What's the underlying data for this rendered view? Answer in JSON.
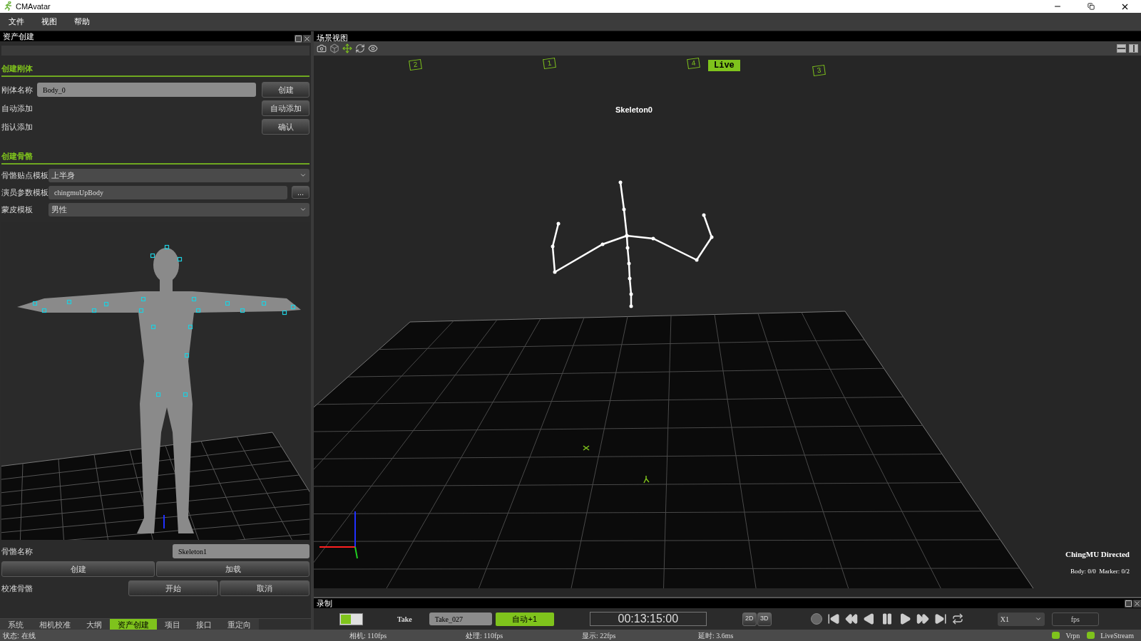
{
  "window": {
    "title": "CMAvatar"
  },
  "menu": [
    "文件",
    "视图",
    "帮助"
  ],
  "left_panel": {
    "title": "资产创建",
    "rigid_section": {
      "heading": "创建刚体",
      "rows": [
        {
          "label": "刚体名称",
          "kind": "field",
          "value": "Body_0",
          "button": "创建"
        },
        {
          "label": "自动添加",
          "kind": "button",
          "button": "自动添加"
        },
        {
          "label": "指认添加",
          "kind": "button",
          "button": "确认"
        }
      ]
    },
    "skeleton_section": {
      "heading": "创建骨骼",
      "rows": [
        {
          "label": "骨骼贴点模板",
          "kind": "dropdown",
          "value": "上半身"
        },
        {
          "label": "演员参数模板",
          "kind": "browse",
          "value": "chingmuUpBody",
          "button": "..."
        },
        {
          "label": "蒙皮模板",
          "kind": "dropdown",
          "value": "男性"
        }
      ]
    },
    "skeleton_name": {
      "label": "骨骼名称",
      "value": "Skeleton1"
    },
    "skeleton_buttons": [
      "创建",
      "加载"
    ],
    "calibrate": {
      "label": "校准骨骼",
      "buttons": [
        "开始",
        "取消"
      ]
    },
    "tabs": [
      {
        "label": "系统",
        "selected": false
      },
      {
        "label": "相机校准",
        "selected": false
      },
      {
        "label": "大纲",
        "selected": false
      },
      {
        "label": "资产创建",
        "selected": true
      },
      {
        "label": "项目",
        "selected": false
      },
      {
        "label": "接口",
        "selected": false
      },
      {
        "label": "重定向",
        "selected": false
      }
    ]
  },
  "scene": {
    "title": "场景视图",
    "camera_markers": [
      "2",
      "1",
      "4",
      "3"
    ],
    "live": "Live",
    "skeleton_label": "Skeleton0",
    "brand": "ChingMU Directed",
    "counts": "Body: 0/0  Marker: 0/2"
  },
  "record": {
    "title": "录制",
    "take_label": "Take",
    "take_value": "Take_027",
    "auto_button": {
      "label": "自动+1",
      "active": true
    },
    "timecode": "00:13:15:00",
    "view_modes": [
      {
        "label": "2D",
        "selected": false
      },
      {
        "label": "3D",
        "selected": false
      }
    ],
    "speed": "X1",
    "fps_placeholder": "fps"
  },
  "status_bar": {
    "status": "状态: 在线",
    "stats": [
      "相机: 110fps",
      "处理: 110fps",
      "显示: 22fps",
      "延时: 3.6ms"
    ],
    "indicators": [
      {
        "label": "Vrpn",
        "color": "#7fc31c"
      },
      {
        "label": "LiveStream",
        "color": "#7fc31c"
      }
    ]
  }
}
